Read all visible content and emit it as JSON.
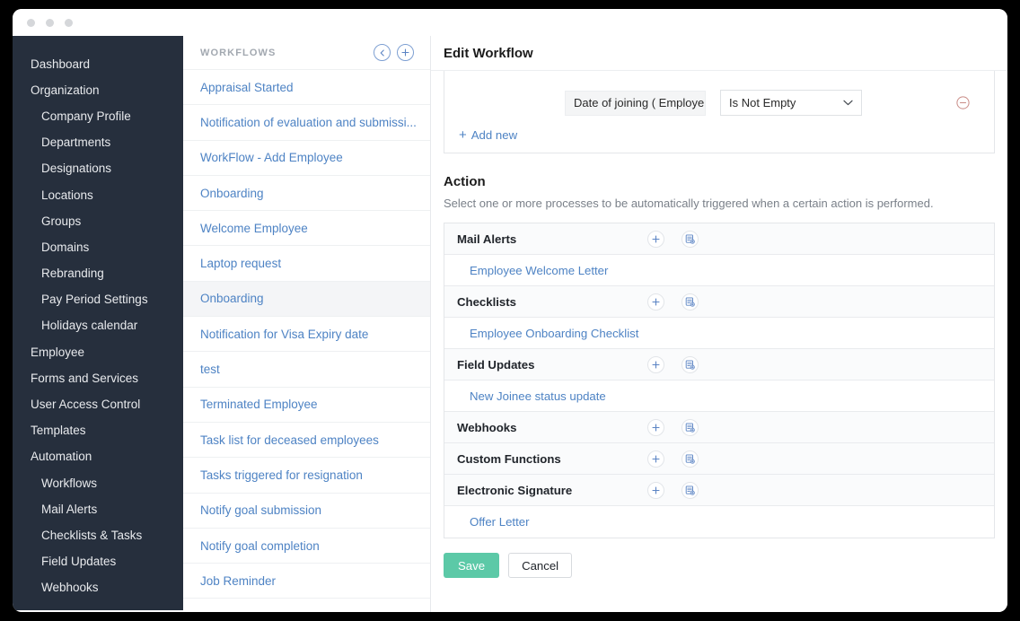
{
  "window": {
    "dots": [
      "close-dot",
      "minimize-dot",
      "maximize-dot"
    ]
  },
  "sidebar": {
    "items": [
      {
        "label": "Dashboard",
        "level": 0
      },
      {
        "label": "Organization",
        "level": 0
      },
      {
        "label": "Company Profile",
        "level": 1
      },
      {
        "label": "Departments",
        "level": 1
      },
      {
        "label": "Designations",
        "level": 1
      },
      {
        "label": "Locations",
        "level": 1
      },
      {
        "label": "Groups",
        "level": 1
      },
      {
        "label": "Domains",
        "level": 1
      },
      {
        "label": "Rebranding",
        "level": 1
      },
      {
        "label": "Pay Period Settings",
        "level": 1
      },
      {
        "label": "Holidays calendar",
        "level": 1
      },
      {
        "label": "Employee",
        "level": 0
      },
      {
        "label": "Forms and Services",
        "level": 0
      },
      {
        "label": "User Access Control",
        "level": 0
      },
      {
        "label": "Templates",
        "level": 0
      },
      {
        "label": "Automation",
        "level": 0
      },
      {
        "label": "Workflows",
        "level": 1
      },
      {
        "label": "Mail Alerts",
        "level": 1
      },
      {
        "label": "Checklists & Tasks",
        "level": 1
      },
      {
        "label": "Field Updates",
        "level": 1
      },
      {
        "label": "Webhooks",
        "level": 1
      }
    ]
  },
  "workflows_panel": {
    "title": "WORKFLOWS",
    "collapse_icon": "chevron-left-icon",
    "add_icon": "plus-icon",
    "items": [
      {
        "label": "Appraisal Started",
        "selected": false
      },
      {
        "label": "Notification of evaluation and submissi...",
        "selected": false
      },
      {
        "label": "WorkFlow - Add Employee",
        "selected": false
      },
      {
        "label": "Onboarding",
        "selected": false
      },
      {
        "label": "Welcome Employee",
        "selected": false
      },
      {
        "label": "Laptop request",
        "selected": false
      },
      {
        "label": "Onboarding",
        "selected": true
      },
      {
        "label": "Notification for Visa Expiry date",
        "selected": false
      },
      {
        "label": "test",
        "selected": false
      },
      {
        "label": "Terminated Employee",
        "selected": false
      },
      {
        "label": "Task list for deceased employees",
        "selected": false
      },
      {
        "label": "Tasks triggered for resignation",
        "selected": false
      },
      {
        "label": "Notify goal submission",
        "selected": false
      },
      {
        "label": "Notify goal completion",
        "selected": false
      },
      {
        "label": "Job Reminder",
        "selected": false
      }
    ]
  },
  "main": {
    "header_title": "Edit Workflow",
    "criteria": {
      "field_value": "Date of joining ( Employe",
      "operator_value": "Is Not Empty",
      "operator_icon": "chevron-down-icon",
      "remove_icon": "circle-minus-icon",
      "add_new_label": "Add new",
      "add_new_icon": "plus-icon"
    },
    "action": {
      "title": "Action",
      "description": "Select one or more processes to be automatically triggered when a certain action is performed.",
      "add_icon": "plus-icon",
      "pick_existing_icon": "document-add-icon",
      "groups": [
        {
          "name": "Mail Alerts",
          "rows": [
            "Employee Welcome Letter"
          ]
        },
        {
          "name": "Checklists",
          "rows": [
            "Employee Onboarding Checklist"
          ]
        },
        {
          "name": "Field Updates",
          "rows": [
            "New Joinee status update"
          ]
        },
        {
          "name": "Webhooks",
          "rows": []
        },
        {
          "name": "Custom Functions",
          "rows": []
        },
        {
          "name": "Electronic Signature",
          "rows": [
            "Offer Letter"
          ]
        }
      ]
    },
    "buttons": {
      "save_label": "Save",
      "cancel_label": "Cancel"
    }
  },
  "colors": {
    "sidebar_bg": "#262f3d",
    "link_blue": "#4e83c4",
    "save_green": "#5cc9a7",
    "remove_red": "#c98b86"
  }
}
